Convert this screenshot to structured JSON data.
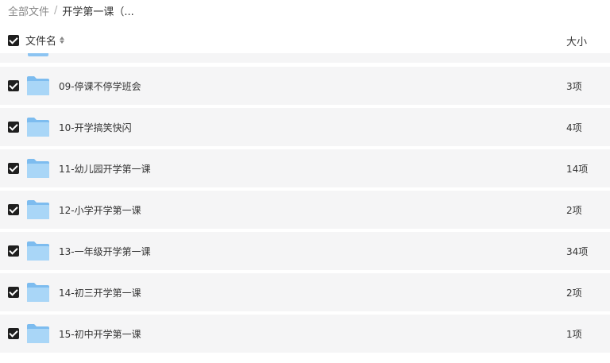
{
  "breadcrumb": {
    "root": "全部文件",
    "separator": "/",
    "current": "开学第一课（..."
  },
  "header": {
    "name_label": "文件名",
    "size_label": "大小",
    "select_all_checked": true
  },
  "rows": [
    {
      "name": "09-停课不停学班会",
      "size": "3项",
      "checked": true,
      "icon": "folder-icon"
    },
    {
      "name": "10-开学搞笑快闪",
      "size": "4项",
      "checked": true,
      "icon": "folder-icon"
    },
    {
      "name": "11-幼儿园开学第一课",
      "size": "14项",
      "checked": true,
      "icon": "folder-icon"
    },
    {
      "name": "12-小学开学第一课",
      "size": "2项",
      "checked": true,
      "icon": "folder-icon"
    },
    {
      "name": "13-一年级开学第一课",
      "size": "34项",
      "checked": true,
      "icon": "folder-icon"
    },
    {
      "name": "14-初三开学第一课",
      "size": "2项",
      "checked": true,
      "icon": "folder-icon"
    },
    {
      "name": "15-初中开学第一课",
      "size": "1项",
      "checked": true,
      "icon": "folder-icon"
    }
  ],
  "colors": {
    "row_background": "#f5f5f6",
    "folder_light": "#a9d6f7",
    "folder_dark": "#7dbcef",
    "checkbox": "#1f1f1f"
  }
}
